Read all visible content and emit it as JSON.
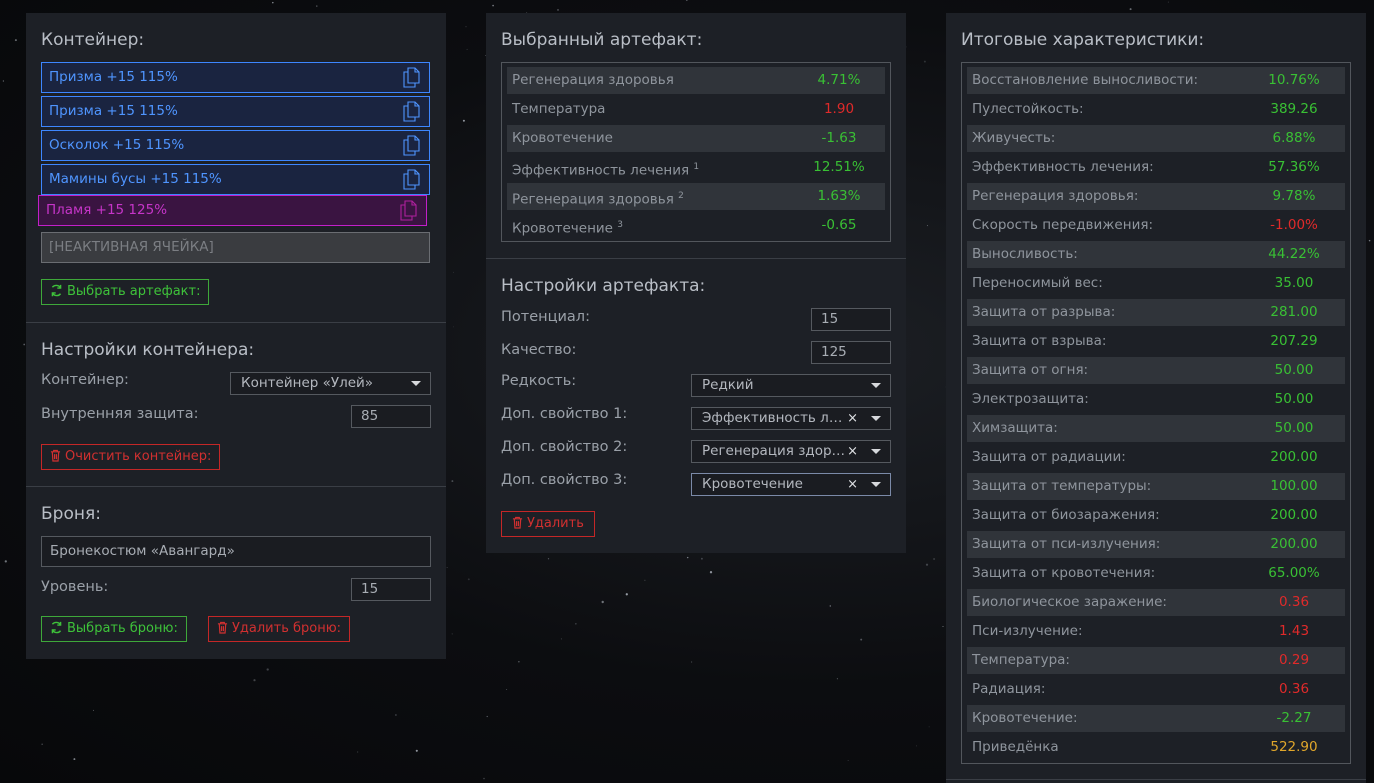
{
  "container_panel": {
    "title": "Контейнер:",
    "slots": [
      {
        "label": "Призма +15 115%",
        "type": "blue"
      },
      {
        "label": "Призма +15 115%",
        "type": "blue"
      },
      {
        "label": "Осколок +15 115%",
        "type": "blue"
      },
      {
        "label": "Мамины бусы +15 115%",
        "type": "blue"
      },
      {
        "label": "Пламя +15 125%",
        "type": "pink"
      }
    ],
    "inactive_slot": "[НЕАКТИВНАЯ ЯЧЕЙКА]",
    "choose_artifact": "Выбрать артефакт:"
  },
  "container_settings": {
    "title": "Настройки контейнера:",
    "container_label": "Контейнер:",
    "container_value": "Контейнер «Улей»",
    "protection_label": "Внутренняя защита:",
    "protection_value": "85",
    "clear_button": "Очистить контейнер:"
  },
  "armor": {
    "title": "Броня:",
    "armor_value": "Бронекостюм «Авангард»",
    "level_label": "Уровень:",
    "level_value": "15",
    "choose_button": "Выбрать броню:",
    "delete_button": "Удалить броню:"
  },
  "selected_artifact": {
    "title": "Выбранный артефакт:",
    "stats": [
      {
        "name": "Регенерация здоровья",
        "sup": "",
        "value": "4.71%",
        "color": "green"
      },
      {
        "name": "Температура",
        "sup": "",
        "value": "1.90",
        "color": "red"
      },
      {
        "name": "Кровотечение",
        "sup": "",
        "value": "-1.63",
        "color": "green"
      },
      {
        "name": "Эффективность лечения",
        "sup": "1",
        "value": "12.51%",
        "color": "green"
      },
      {
        "name": "Регенерация здоровья",
        "sup": "2",
        "value": "1.63%",
        "color": "green"
      },
      {
        "name": "Кровотечение",
        "sup": "3",
        "value": "-0.65",
        "color": "green"
      }
    ]
  },
  "artifact_settings": {
    "title": "Настройки артефакта:",
    "potential_label": "Потенциал:",
    "potential_value": "15",
    "quality_label": "Качество:",
    "quality_value": "125",
    "rarity_label": "Редкость:",
    "rarity_value": "Редкий",
    "extra1_label": "Доп. свойство 1:",
    "extra1_value": "Эффективность лечения",
    "extra2_label": "Доп. свойство 2:",
    "extra2_value": "Регенерация здоровья",
    "extra3_label": "Доп. свойство 3:",
    "extra3_value": "Кровотечение",
    "delete_button": "Удалить"
  },
  "totals": {
    "title": "Итоговые характеристики:",
    "stats": [
      {
        "name": "Восстановление выносливости:",
        "value": "10.76%",
        "color": "green"
      },
      {
        "name": "Пулестойкость:",
        "value": "389.26",
        "color": "green"
      },
      {
        "name": "Живучесть:",
        "value": "6.88%",
        "color": "green"
      },
      {
        "name": "Эффективность лечения:",
        "value": "57.36%",
        "color": "green"
      },
      {
        "name": "Регенерация здоровья:",
        "value": "9.78%",
        "color": "green"
      },
      {
        "name": "Скорость передвижения:",
        "value": "-1.00%",
        "color": "red"
      },
      {
        "name": "Выносливость:",
        "value": "44.22%",
        "color": "green"
      },
      {
        "name": "Переносимый вес:",
        "value": "35.00",
        "color": "green"
      },
      {
        "name": "Защита от разрыва:",
        "value": "281.00",
        "color": "green"
      },
      {
        "name": "Защита от взрыва:",
        "value": "207.29",
        "color": "green"
      },
      {
        "name": "Защита от огня:",
        "value": "50.00",
        "color": "green"
      },
      {
        "name": "Электрозащита:",
        "value": "50.00",
        "color": "green"
      },
      {
        "name": "Химзащита:",
        "value": "50.00",
        "color": "green"
      },
      {
        "name": "Защита от радиации:",
        "value": "200.00",
        "color": "green"
      },
      {
        "name": "Защита от температуры:",
        "value": "100.00",
        "color": "green"
      },
      {
        "name": "Защита от биозаражения:",
        "value": "200.00",
        "color": "green"
      },
      {
        "name": "Защита от пси-излучения:",
        "value": "200.00",
        "color": "green"
      },
      {
        "name": "Защита от кровотечения:",
        "value": "65.00%",
        "color": "green"
      },
      {
        "name": "Биологическое заражение:",
        "value": "0.36",
        "color": "red"
      },
      {
        "name": "Пси-излучение:",
        "value": "1.43",
        "color": "red"
      },
      {
        "name": "Температура:",
        "value": "0.29",
        "color": "red"
      },
      {
        "name": "Радиация:",
        "value": "0.36",
        "color": "red"
      },
      {
        "name": "Кровотечение:",
        "value": "-2.27",
        "color": "green"
      },
      {
        "name": "Приведёнка",
        "value": "522.90",
        "color": "gold"
      }
    ]
  },
  "colors": {
    "accent_blue": "#3d86ff",
    "accent_pink": "#c21fc8",
    "positive": "#39c034",
    "negative": "#e02a2a",
    "highlight": "#e0a62b"
  }
}
